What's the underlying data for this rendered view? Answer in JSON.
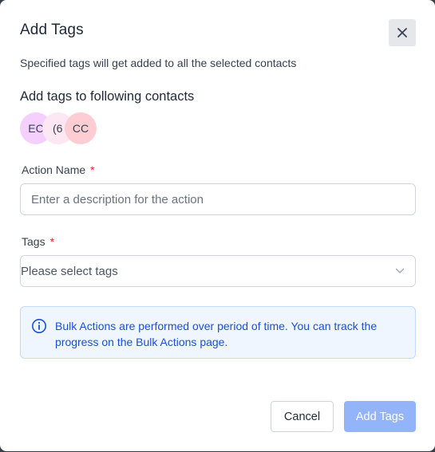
{
  "modal": {
    "title": "Add Tags",
    "subtitle": "Specified tags will get added to all the selected contacts",
    "contacts_heading": "Add tags to following contacts",
    "avatars": [
      {
        "initials": "EC",
        "color": "#f5d0fe"
      },
      {
        "initials": "(6",
        "color": "#fce7f3"
      },
      {
        "initials": "CC",
        "color": "#fecdd3"
      }
    ]
  },
  "form": {
    "action_name": {
      "label": "Action Name",
      "required_mark": "*",
      "placeholder": "Enter a description for the action",
      "value": ""
    },
    "tags": {
      "label": "Tags",
      "required_mark": "*",
      "placeholder": "Please select tags"
    }
  },
  "info": {
    "icon": "info-circle-icon",
    "text": "Bulk Actions are performed over period of time. You can track the progress on the Bulk Actions page."
  },
  "footer": {
    "cancel_label": "Cancel",
    "submit_label": "Add Tags"
  },
  "colors": {
    "primary_disabled": "#93b4f8",
    "info_text": "#1d4ed8",
    "required": "#dc2626"
  }
}
